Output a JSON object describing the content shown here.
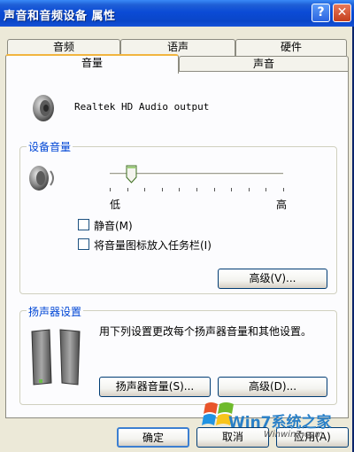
{
  "window": {
    "title": "声音和音频设备 属性",
    "help_label": "?",
    "close_label": "✕"
  },
  "tabs_back": [
    {
      "label": "音频"
    },
    {
      "label": "语声"
    },
    {
      "label": "硬件"
    }
  ],
  "tabs_front": [
    {
      "label": "音量",
      "active": true
    },
    {
      "label": "声音",
      "active": false
    }
  ],
  "device": {
    "icon": "speaker-icon",
    "name": "Realtek HD Audio output"
  },
  "device_volume": {
    "group_title": "设备音量",
    "icon": "speaker-icon",
    "slider_level_fraction": 0.12,
    "low_label": "低",
    "high_label": "高",
    "mute_label": "静音(M)",
    "mute_checked": false,
    "taskbar_label": "将音量图标放入任务栏(I)",
    "taskbar_checked": false,
    "advanced_label": "高级(V)..."
  },
  "speaker_settings": {
    "group_title": "扬声器设置",
    "icon": "speakers-icon",
    "description": "用下列设置更改每个扬声器音量和其他设置。",
    "speaker_volume_label": "扬声器音量(S)...",
    "advanced_label": "高级(D)..."
  },
  "footer": {
    "ok_label": "确定",
    "cancel_label": "取消",
    "apply_label": "应用(A)"
  },
  "watermark": {
    "brand": "Win7系统之家",
    "url": "Winwin7.com"
  }
}
